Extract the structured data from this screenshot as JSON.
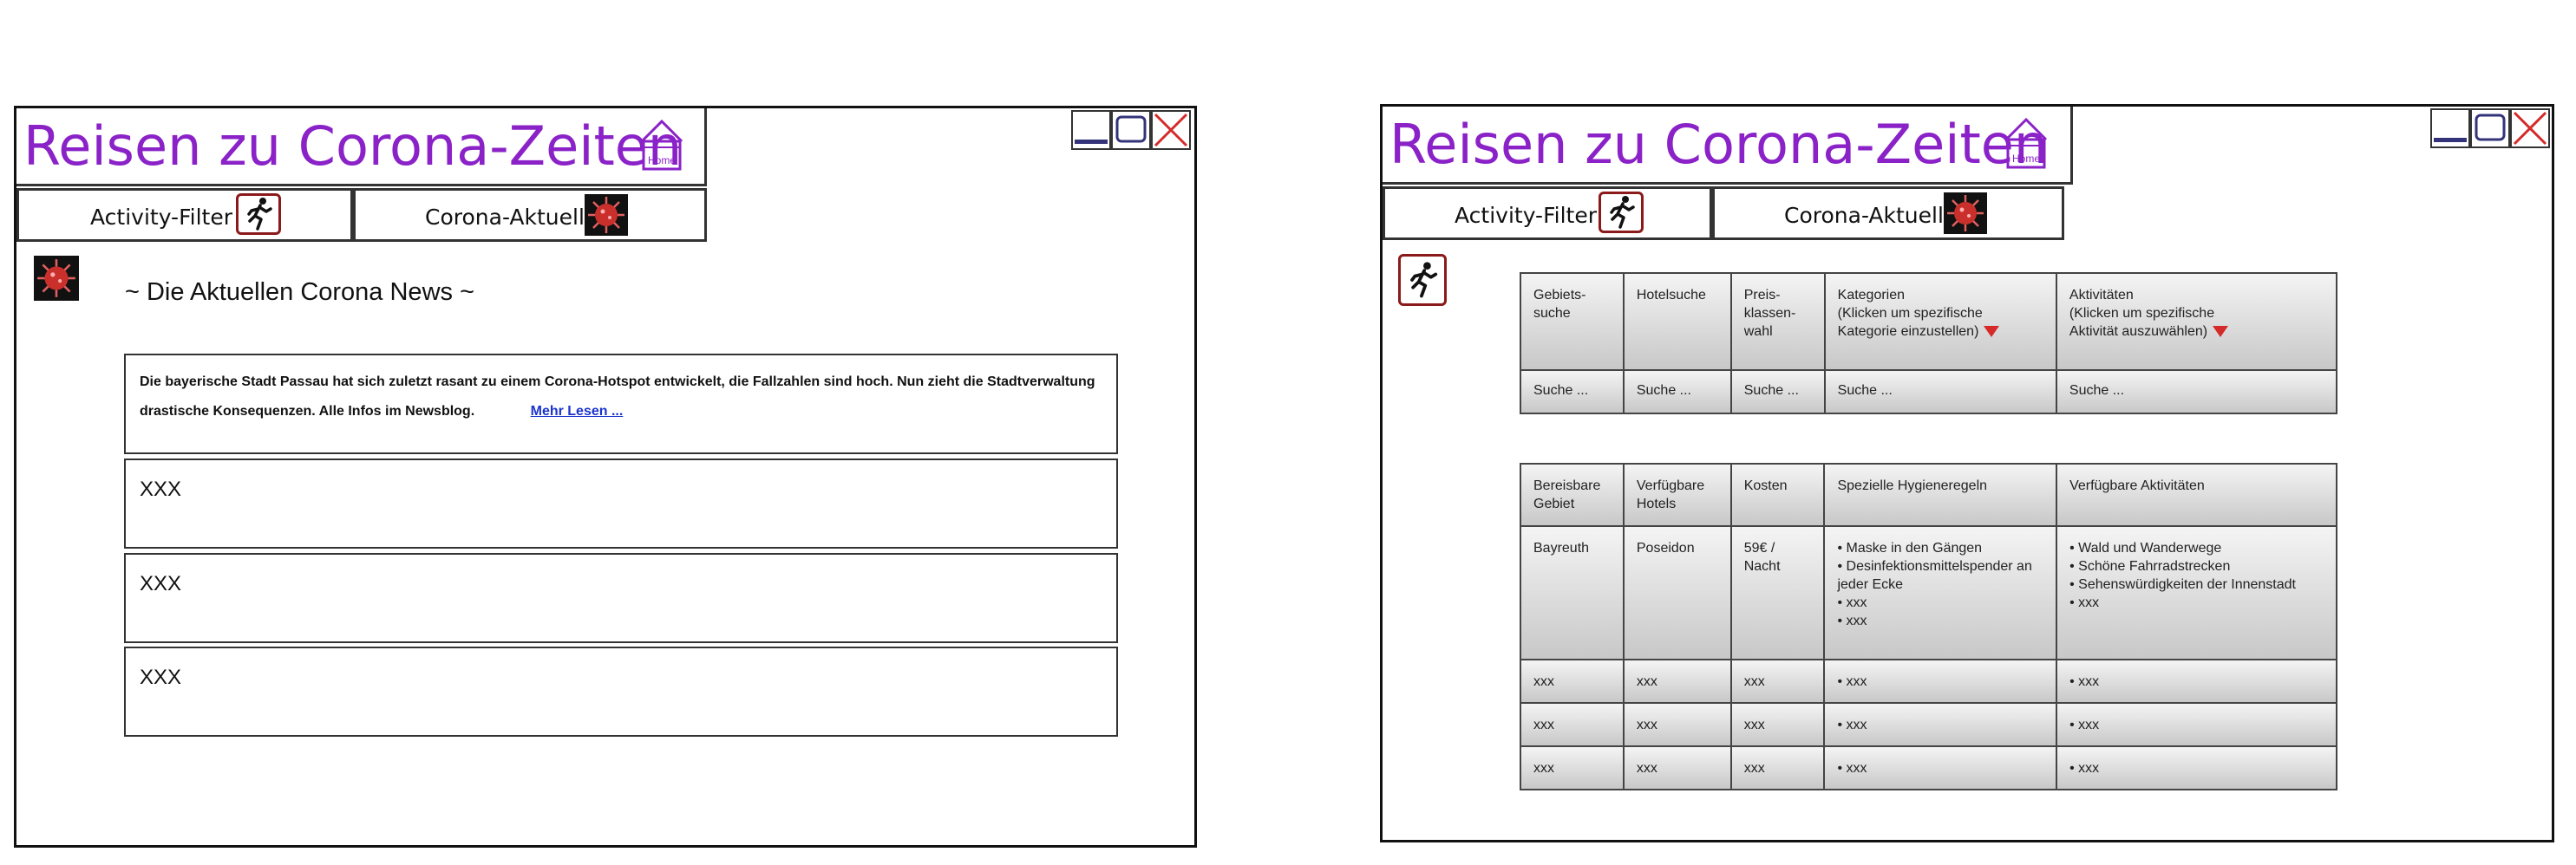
{
  "app": {
    "title": "Reisen zu Corona-Zeiten",
    "home_label": "Home",
    "accent_color": "#8a22c8"
  },
  "nav": {
    "activity_filter": "Activity-Filter",
    "corona_aktuell": "Corona-Aktuell"
  },
  "news": {
    "heading": "~ Die Aktuellen Corona News ~",
    "article_text": "Die bayerische Stadt Passau hat sich zuletzt rasant zu einem Corona-Hotspot entwickelt, die Fallzahlen sind hoch. Nun zieht die Stadtverwaltung drastische Konsequenzen. Alle Infos im Newsblog.",
    "read_more": "Mehr Lesen ...",
    "placeholders": [
      "XXX",
      "XXX",
      "XXX"
    ]
  },
  "search": {
    "headers": [
      [
        "Gebiets-",
        "suche"
      ],
      [
        "Hotelsuche"
      ],
      [
        "Preis-",
        "klassen-",
        "wahl"
      ],
      [
        "Kategorien",
        "(Klicken um spezifische",
        "Kategorie einzustellen)"
      ],
      [
        "Aktivitäten",
        "(Klicken um spezifische",
        "Aktivität auszuwählen)"
      ]
    ],
    "inputs": [
      "Suche ...",
      "Suche ...",
      "Suche ...",
      "Suche ...",
      "Suche ..."
    ]
  },
  "results": {
    "headers": [
      [
        "Bereisbare",
        "Gebiet"
      ],
      [
        "Verfügbare",
        "Hotels"
      ],
      [
        "Kosten"
      ],
      [
        "Spezielle Hygieneregeln"
      ],
      [
        "Verfügbare Aktivitäten"
      ]
    ],
    "first_row": {
      "gebiet": "Bayreuth",
      "hotel": "Poseidon",
      "kosten": [
        "59€ /",
        "Nacht"
      ],
      "hygiene": [
        "• Maske in den Gängen",
        "• Desinfektionsmittelspender an",
        "jeder Ecke",
        "• xxx",
        "• xxx"
      ],
      "aktivitaeten": [
        "• Wald und Wanderwege",
        "• Schöne Fahrradstrecken",
        "• Sehenswürdigkeiten der Innenstadt",
        "• xxx"
      ]
    },
    "rows": [
      [
        "xxx",
        "xxx",
        "xxx",
        "• xxx",
        "• xxx"
      ],
      [
        "xxx",
        "xxx",
        "xxx",
        "• xxx",
        "• xxx"
      ],
      [
        "xxx",
        "xxx",
        "xxx",
        "• xxx",
        "• xxx"
      ]
    ]
  }
}
